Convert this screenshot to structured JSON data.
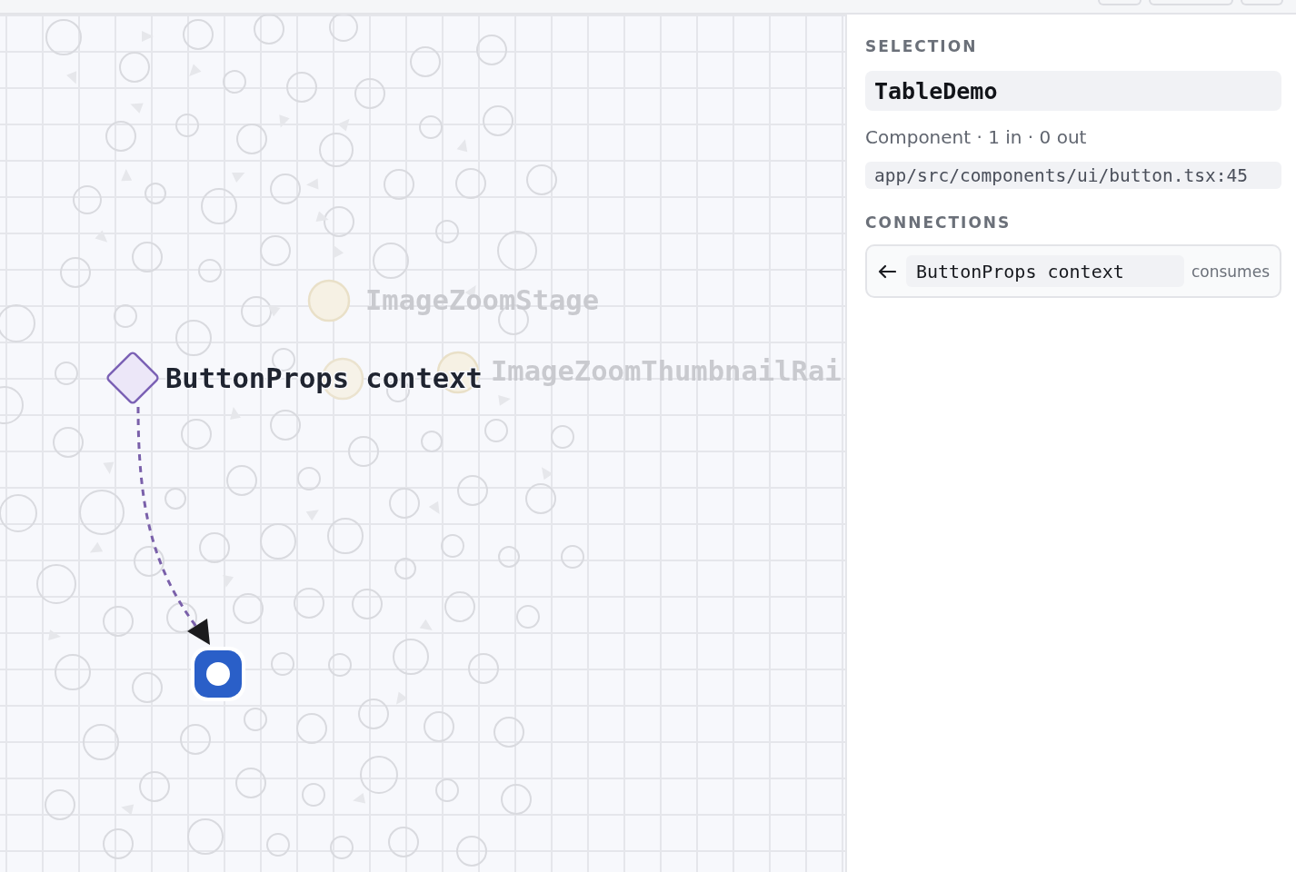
{
  "canvas": {
    "nodes": [
      {
        "kind": "context",
        "label": "ButtonProps context",
        "selected": false,
        "dimmed": false
      },
      {
        "kind": "component",
        "selected": true,
        "dimmed": false
      },
      {
        "kind": "component",
        "label": "ImageZoomStage",
        "selected": false,
        "dimmed": true
      },
      {
        "kind": "component",
        "label": "ImageZoomThumbnailRai",
        "selected": false,
        "dimmed": true
      }
    ]
  },
  "inspector": {
    "selection_heading": "SELECTION",
    "name": "TableDemo",
    "summary": "Component · 1 in · 0 out",
    "path": "app/src/components/ui/button.tsx:45",
    "connections_heading": "CONNECTIONS",
    "connections": [
      {
        "incoming": true,
        "node": "ButtonProps context",
        "relation": "consumes"
      }
    ]
  }
}
